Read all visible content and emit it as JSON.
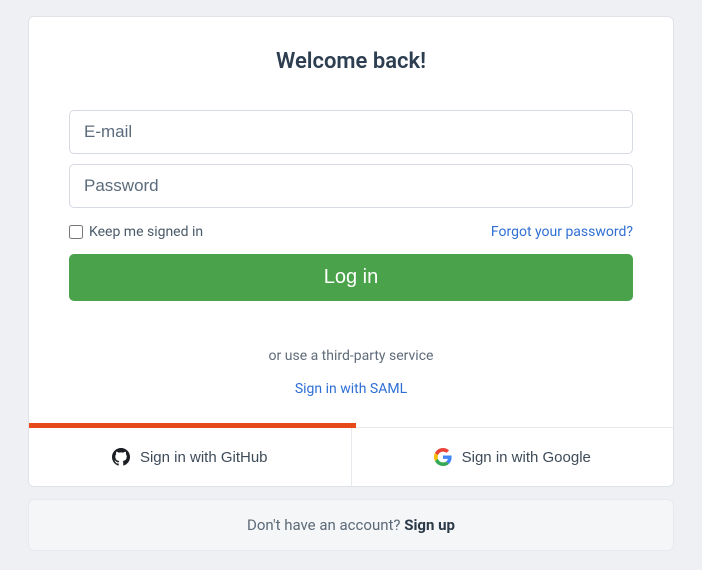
{
  "heading": "Welcome back!",
  "email": {
    "placeholder": "E-mail",
    "value": ""
  },
  "password": {
    "placeholder": "Password",
    "value": ""
  },
  "keep_signed_in_label": "Keep me signed in",
  "forgot_password": "Forgot your password?",
  "login_button": "Log in",
  "third_party_text": "or use a third-party service",
  "saml_link": "Sign in with SAML",
  "github_button": "Sign in with GitHub",
  "google_button": "Sign in with Google",
  "signup_prompt": "Don't have an account? ",
  "signup_action": "Sign up"
}
